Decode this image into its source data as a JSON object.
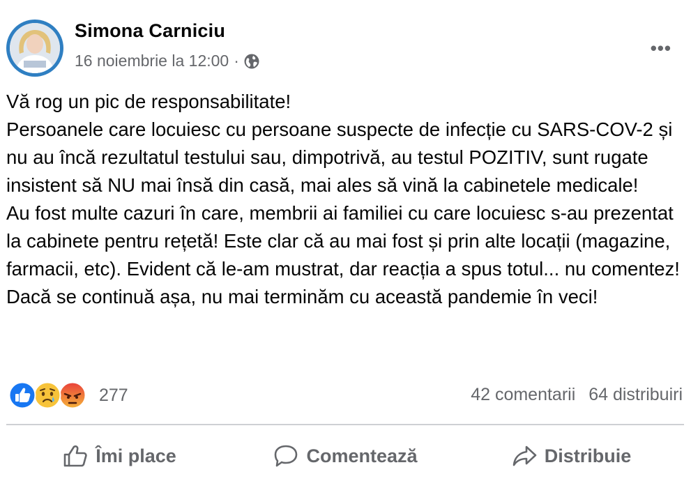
{
  "post": {
    "author": "Simona Carniciu",
    "timestamp": "16 noiembrie la 12:00",
    "separator": "·",
    "audience_icon": "globe-icon",
    "more_label": "•••",
    "paragraphs": [
      "Vă rog un pic de responsabilitate!",
      "Persoanele care locuiesc cu persoane suspecte de infecție cu SARS-COV-2 și nu au încă rezultatul testului sau, dimpotrivă, au testul POZITIV, sunt rugate insistent să NU mai însă din casă, mai ales să vină la cabinetele medicale!",
      "Au fost multe cazuri în care, membrii ai familiei cu care locuiesc s-au prezentat la cabinete pentru rețetă! Este clar că au mai fost și prin alte locații (magazine, farmacii, etc). Evident că le-am mustrat, dar reacția a spus totul... nu comentez!",
      "Dacă se continuă așa, nu mai terminăm cu această pandemie în veci!"
    ]
  },
  "engagement": {
    "reaction_icons": [
      "like-icon",
      "sad-icon",
      "angry-icon"
    ],
    "reaction_count": "277",
    "comments": "42 comentarii",
    "shares": "64 distribuiri"
  },
  "actions": {
    "like_label": "Îmi place",
    "comment_label": "Comentează",
    "share_label": "Distribuie"
  },
  "colors": {
    "text": "#050505",
    "secondary": "#65676b",
    "like_blue": "#1877f2",
    "angry_red": "#e9710f",
    "divider": "#ced0d4"
  }
}
